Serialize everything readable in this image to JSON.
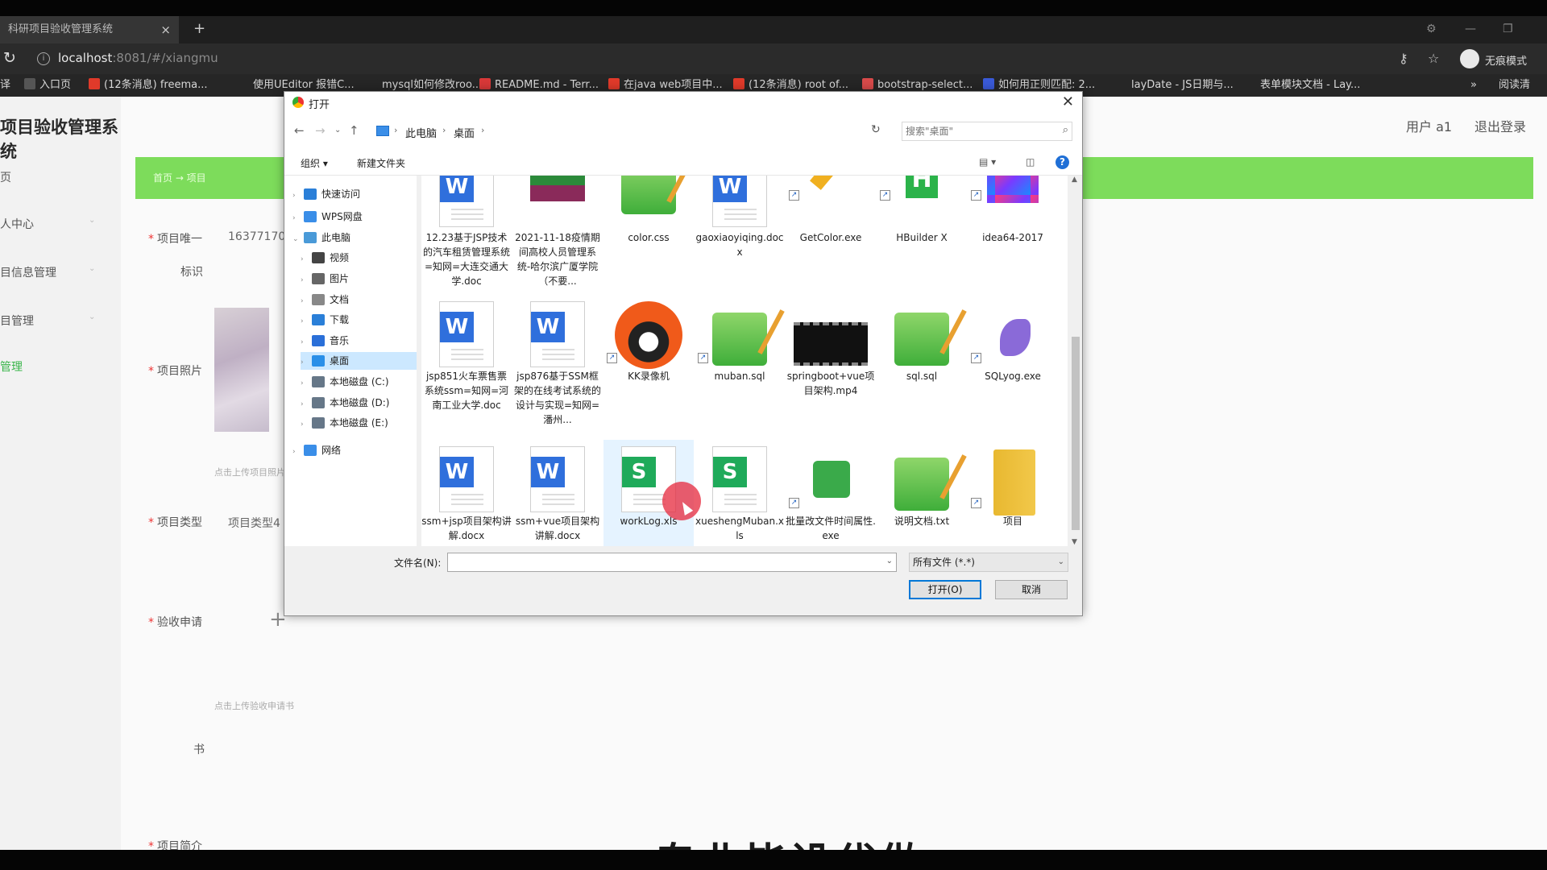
{
  "browser": {
    "tab_title": "科研项目验收管理系统",
    "tab_close": "×",
    "new_tab": "+",
    "url_host": "localhost",
    "url_rest": ":8081/#/xiangmu",
    "incognito_label": "无痕模式",
    "bookmarks": [
      {
        "label": "译",
        "color": "#262626"
      },
      {
        "label": "入口页",
        "color": "#555555"
      },
      {
        "label": "(12条消息) freema...",
        "color": "#e03a2a"
      },
      {
        "label": "使用UEditor 报错C...",
        "color": "#262626"
      },
      {
        "label": "mysql如何修改roo...",
        "color": "#262626"
      },
      {
        "label": "README.md - Terr...",
        "color": "#d83838"
      },
      {
        "label": "在java web项目中...",
        "color": "#e03a2a"
      },
      {
        "label": "(12条消息) root of...",
        "color": "#e03a2a"
      },
      {
        "label": "bootstrap-select...",
        "color": "#d84a4a"
      },
      {
        "label": "如何用正则匹配: 2...",
        "color": "#3a5ad8"
      },
      {
        "label": "layDate - JS日期与...",
        "color": "#262626"
      },
      {
        "label": "表单模块文档 - Lay...",
        "color": "#262626"
      }
    ],
    "more": "»",
    "reading_list": "阅读清"
  },
  "webpage": {
    "site_title": "项目验收管理系统",
    "user_label": "用户 a1",
    "logout": "退出登录",
    "breadcrumb": "首页  →  项目",
    "sidebar": [
      {
        "label": "页"
      },
      {
        "label": "人中心"
      },
      {
        "label": "目信息管理"
      },
      {
        "label": "目管理"
      },
      {
        "label": "管理"
      }
    ],
    "form": {
      "field1_label": "项目唯一",
      "field1_label2": "标识",
      "field1_value": "16377170",
      "photo_label": "项目照片",
      "photo_hint": "点击上传项目照片",
      "type_label": "项目类型",
      "type_value": "项目类型4",
      "apply_label": "验收申请",
      "apply_hint": "点击上传验收申请书",
      "apply_label2": "书",
      "intro_label": "项目简介"
    },
    "overlay_text": "专业毕设代做"
  },
  "dialog": {
    "title": "打开",
    "close": "✕",
    "breadcrumb": [
      "此电脑",
      "桌面"
    ],
    "search_placeholder": "搜索\"桌面\"",
    "toolbar_organize": "组织 ▾",
    "toolbar_new_folder": "新建文件夹",
    "help": "?",
    "nav_tree": [
      {
        "label": "快速访问",
        "color": "#2a7fd8"
      },
      {
        "label": "WPS网盘",
        "color": "#3a8ee8"
      },
      {
        "label": "此电脑",
        "color": "#4a9ad8"
      },
      {
        "label": "视频",
        "color": "#444444"
      },
      {
        "label": "图片",
        "color": "#666666"
      },
      {
        "label": "文档",
        "color": "#888888"
      },
      {
        "label": "下载",
        "color": "#2a7fd8"
      },
      {
        "label": "音乐",
        "color": "#2a6fd8"
      },
      {
        "label": "桌面",
        "color": "#2a8fe8"
      },
      {
        "label": "本地磁盘 (C:)",
        "color": "#667788"
      },
      {
        "label": "本地磁盘 (D:)",
        "color": "#667788"
      },
      {
        "label": "本地磁盘 (E:)",
        "color": "#667788"
      },
      {
        "label": "网络",
        "color": "#3a8ee8"
      }
    ],
    "files": [
      {
        "name": "12.23基于JSP技术的汽车租赁管理系统=知网=大连交通大学.doc",
        "icon": "word-icon",
        "kind": "doc",
        "color": "#2f6fdc"
      },
      {
        "name": "2021-11-18疫情期间高校人员管理系统-哈尔滨广厦学院（不要...",
        "icon": "winrar-icon",
        "kind": "rar",
        "color": "#8a2a5a"
      },
      {
        "name": "color.css",
        "icon": "notepad-icon",
        "kind": "np",
        "color": "#4ab03a"
      },
      {
        "name": "gaoxiaoyiqing.docx",
        "icon": "word-icon",
        "kind": "doc",
        "color": "#2f6fdc"
      },
      {
        "name": "GetColor.exe",
        "icon": "pencil-icon",
        "kind": "pencil",
        "color": "#f0b020"
      },
      {
        "name": "HBuilder X",
        "icon": "hbuilder-icon",
        "kind": "hb",
        "color": "#2bb34a"
      },
      {
        "name": "idea64-2017",
        "icon": "idea-icon",
        "kind": "idea",
        "color": "#1a1a1a"
      },
      {
        "name": "jsp851火车票售票系统ssm=知网=河南工业大学.doc",
        "icon": "word-icon",
        "kind": "doc",
        "color": "#2f6fdc"
      },
      {
        "name": "jsp876基于SSM框架的在线考试系统的设计与实现=知网=潘州...",
        "icon": "word-icon",
        "kind": "doc",
        "color": "#2f6fdc"
      },
      {
        "name": "KK录像机",
        "icon": "kk-recorder-icon",
        "kind": "kk",
        "color": "#f05a1a"
      },
      {
        "name": "muban.sql",
        "icon": "notepad-icon",
        "kind": "np",
        "color": "#4ab03a"
      },
      {
        "name": "springboot+vue项目架构.mp4",
        "icon": "video-icon",
        "kind": "video",
        "color": "#111111"
      },
      {
        "name": "sql.sql",
        "icon": "notepad-icon",
        "kind": "np",
        "color": "#4ab03a"
      },
      {
        "name": "SQLyog.exe",
        "icon": "dolphin-icon",
        "kind": "dolphin",
        "color": "#8a6ad8"
      },
      {
        "name": "ssm+jsp项目架构讲解.docx",
        "icon": "word-icon",
        "kind": "doc",
        "color": "#2f6fdc"
      },
      {
        "name": "ssm+vue项目架构讲解.docx",
        "icon": "word-icon",
        "kind": "doc",
        "color": "#2f6fdc"
      },
      {
        "name": "workLog.xls",
        "icon": "wps-sheet-icon",
        "kind": "xls",
        "color": "#1faa5a"
      },
      {
        "name": "xueshengMuban.xls",
        "icon": "wps-sheet-icon",
        "kind": "xls",
        "color": "#1faa5a"
      },
      {
        "name": "批量改文件时间属性.exe",
        "icon": "android-icon",
        "kind": "android",
        "color": "#3aaa4a"
      },
      {
        "name": "说明文档.txt",
        "icon": "notepad-icon",
        "kind": "np",
        "color": "#4ab03a"
      },
      {
        "name": "项目",
        "icon": "folder-icon",
        "kind": "folder",
        "color": "#f2c84a"
      }
    ],
    "filename_label": "文件名(N):",
    "filename_value": "",
    "filetype": "所有文件 (*.*)",
    "open_button": "打开(O)",
    "cancel_button": "取消"
  }
}
